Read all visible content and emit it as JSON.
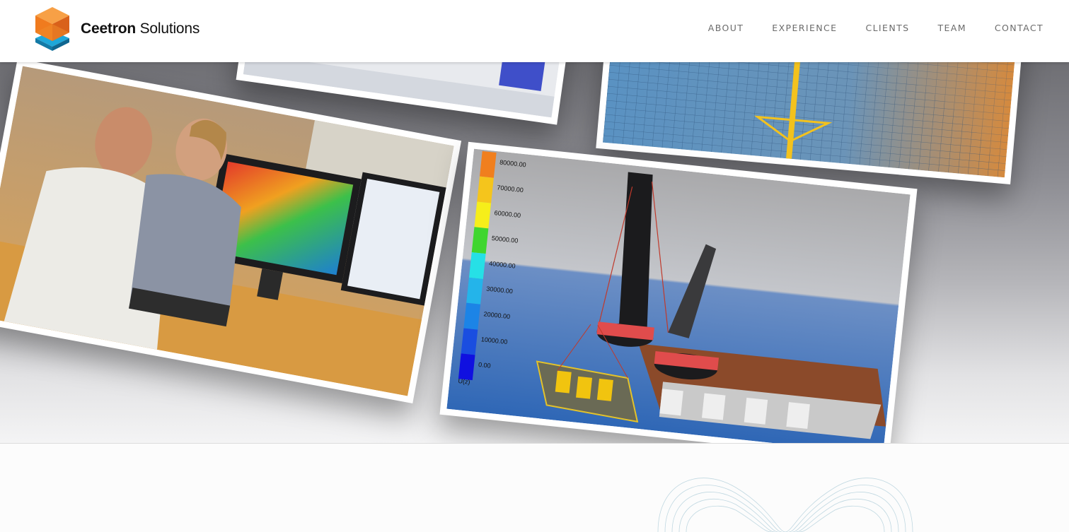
{
  "header": {
    "brand_bold": "Ceetron",
    "brand_rest": "Solutions",
    "logo_icon": "layered-cubes-icon"
  },
  "nav": {
    "items": [
      "ABOUT",
      "EXPERIENCE",
      "CLIENTS",
      "TEAM",
      "CONTACT"
    ]
  },
  "hero": {
    "legend_values": [
      "80000.00",
      "70000.00",
      "60000.00",
      "50000.00",
      "40000.00",
      "30000.00",
      "20000.00",
      "10000.00",
      "0.00"
    ],
    "legend_title": "U(z)"
  },
  "colors": {
    "logo_orange": "#f07b1e",
    "logo_blue": "#1ea7d9",
    "nav_text": "#6b6b6b",
    "hero_gray": "#8c8c92"
  }
}
